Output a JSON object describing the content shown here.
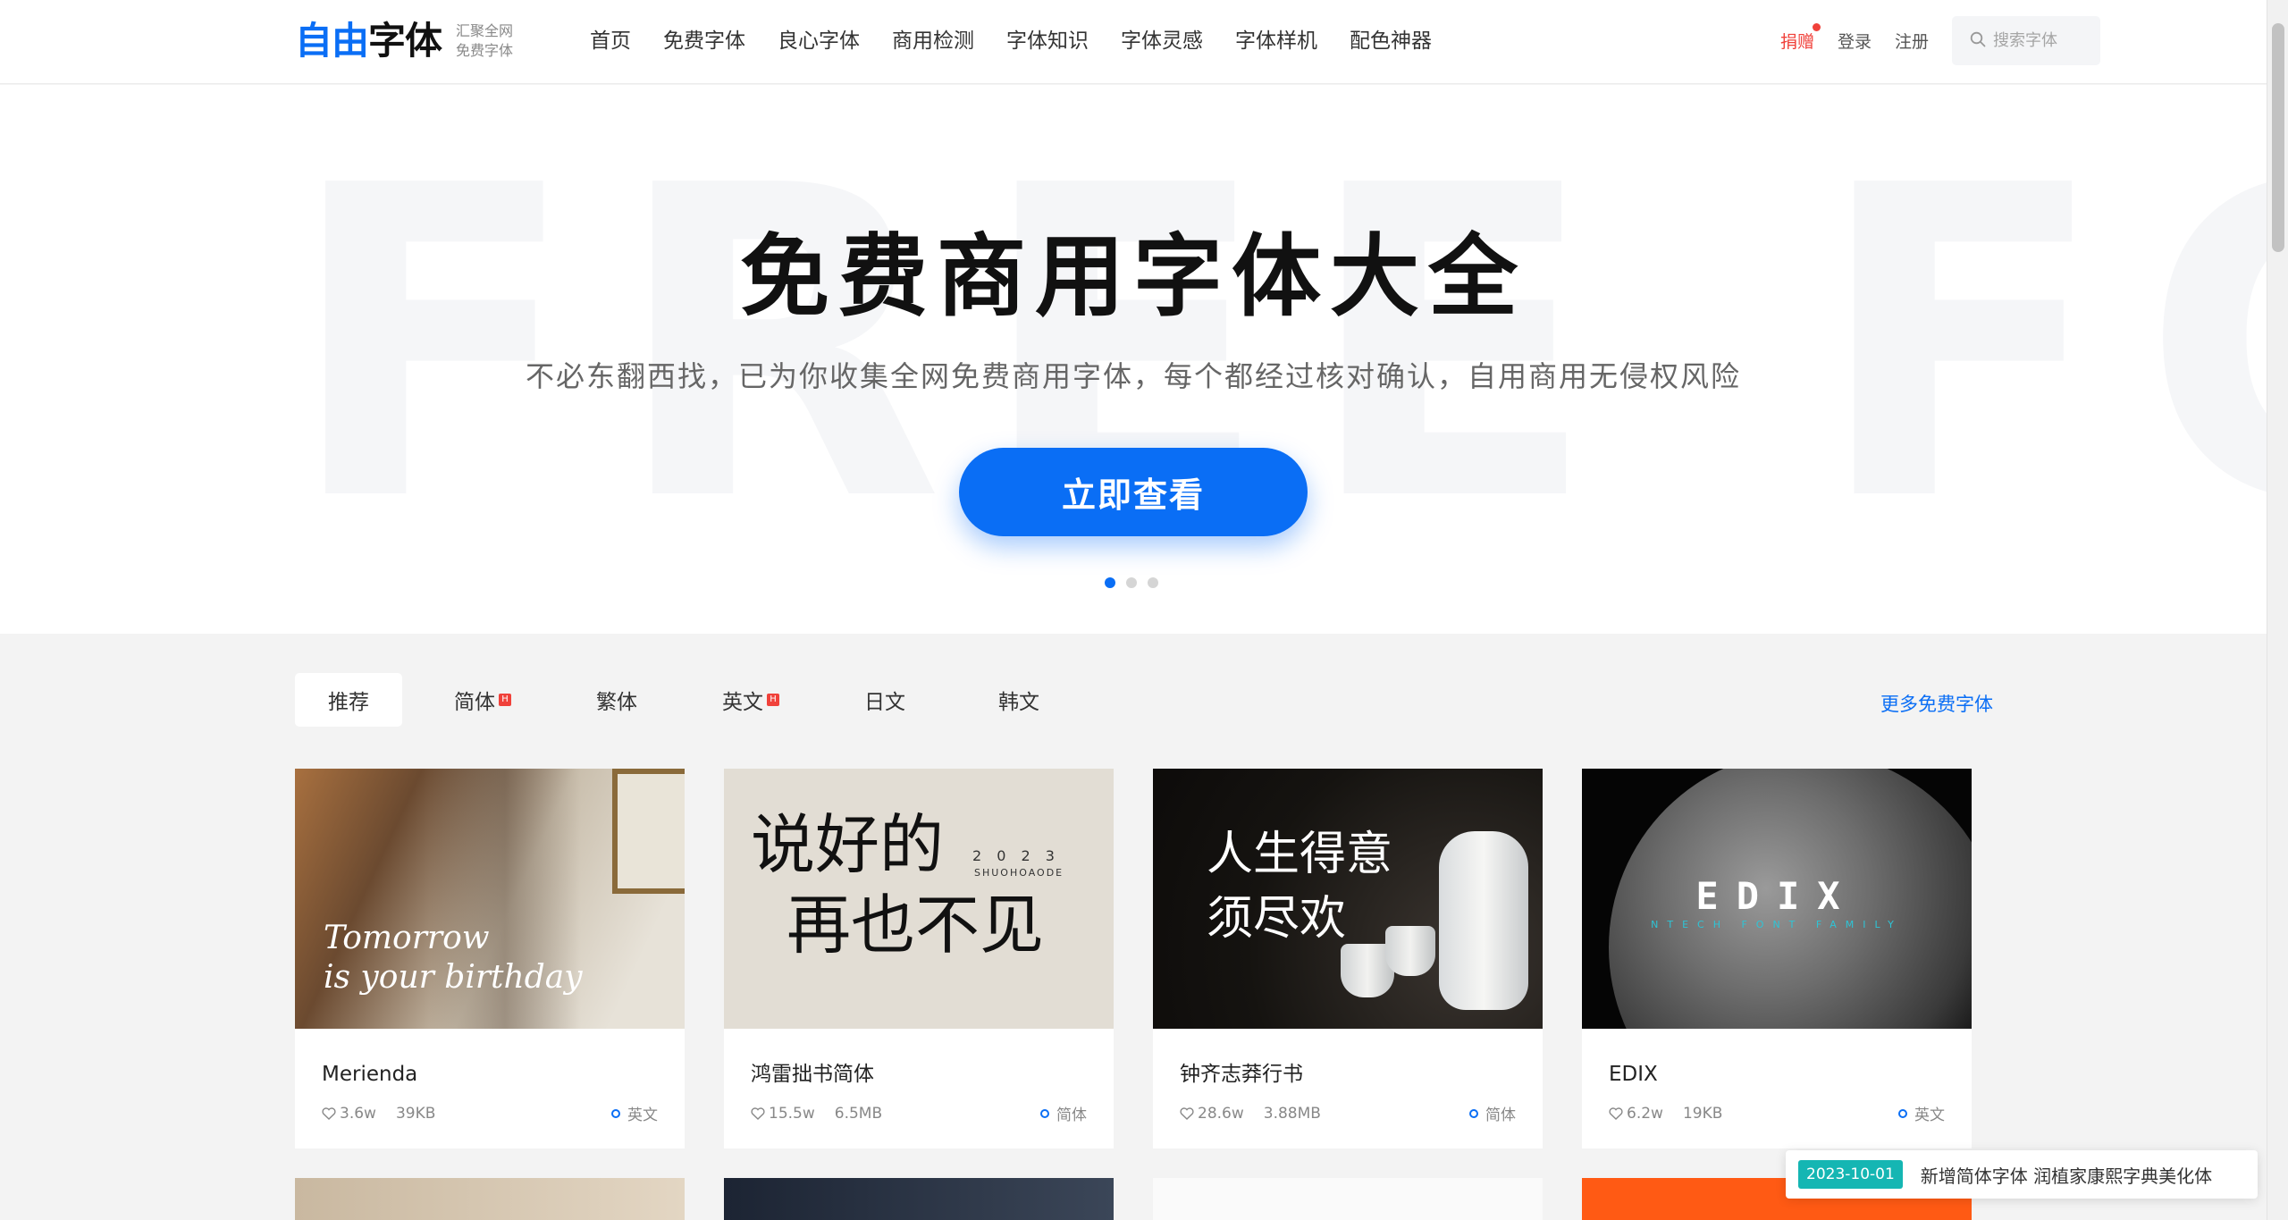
{
  "header": {
    "logo_blue": "自由",
    "logo_black": "字体",
    "slogan_line1": "汇聚全网",
    "slogan_line2": "免费字体",
    "nav": [
      {
        "label": "首页"
      },
      {
        "label": "免费字体"
      },
      {
        "label": "良心字体"
      },
      {
        "label": "商用检测"
      },
      {
        "label": "字体知识"
      },
      {
        "label": "字体灵感"
      },
      {
        "label": "字体样机"
      },
      {
        "label": "配色神器"
      }
    ],
    "donate": "捐赠",
    "login": "登录",
    "register": "注册",
    "search_placeholder": "搜索字体"
  },
  "hero": {
    "bg_text": "FREE FO",
    "title": "免费商用字体大全",
    "subtitle": "不必东翻西找，已为你收集全网免费商用字体，每个都经过核对确认，自用商用无侵权风险",
    "button": "立即查看",
    "slides": 3,
    "active_slide": 1
  },
  "tabs": {
    "items": [
      {
        "label": "推荐",
        "hot": false
      },
      {
        "label": "简体",
        "hot": true
      },
      {
        "label": "繁体",
        "hot": false
      },
      {
        "label": "英文",
        "hot": true
      },
      {
        "label": "日文",
        "hot": false
      },
      {
        "label": "韩文",
        "hot": false
      }
    ],
    "active": "推荐",
    "hot_mark": "H",
    "more": "更多免费字体"
  },
  "cards": [
    {
      "title": "Merienda",
      "likes": "3.6w",
      "size": "39KB",
      "lang": "英文",
      "img_text_1": "Tomorrow",
      "img_text_2": "is your birthday"
    },
    {
      "title": "鸿雷拙书简体",
      "likes": "15.5w",
      "size": "6.5MB",
      "lang": "简体",
      "img_text_1": "说好的",
      "img_text_2": "再也不见",
      "img_small": "2 0 2 3",
      "img_small2": "SHUOHOAODE"
    },
    {
      "title": "钟齐志莽行书",
      "likes": "28.6w",
      "size": "3.88MB",
      "lang": "简体",
      "img_text_1": "人生得意",
      "img_text_2": "须尽欢"
    },
    {
      "title": "EDIX",
      "likes": "6.2w",
      "size": "19KB",
      "lang": "英文",
      "img_text_1": "EDIX",
      "img_small": "NTECH FONT FAMILY"
    }
  ],
  "toast": {
    "date": "2023-10-01",
    "text": "新增简体字体 润植家康熙字典美化体"
  },
  "colors": {
    "accent": "#0a6ef5",
    "donate": "#f0413a",
    "toast_badge": "#15b6b3"
  }
}
